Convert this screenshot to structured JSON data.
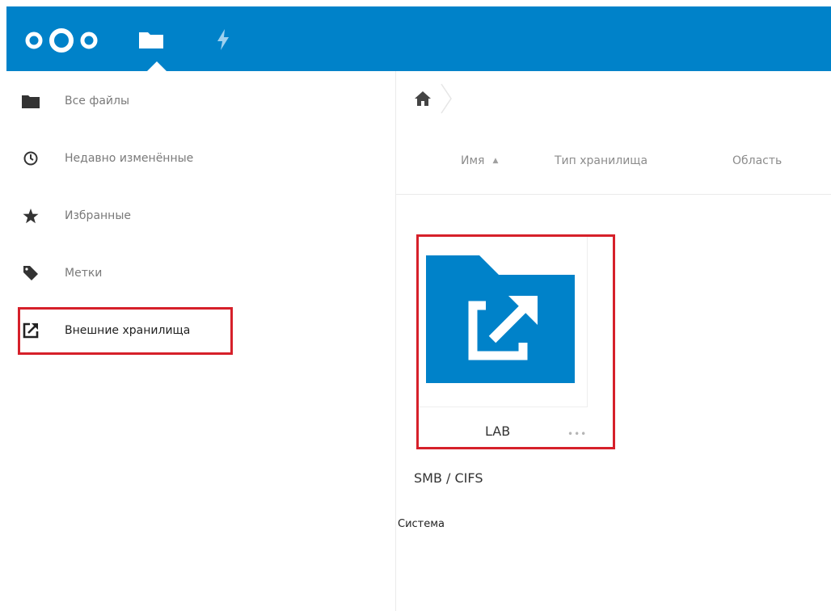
{
  "header": {
    "logo_icon": "nextcloud-logo",
    "nav": [
      {
        "icon": "folder-icon",
        "active": true
      },
      {
        "icon": "activity-icon",
        "active": false
      }
    ],
    "bar_color": "#0082c9"
  },
  "sidebar": {
    "items": [
      {
        "icon": "folder-icon",
        "label": "Все файлы"
      },
      {
        "icon": "clock-icon",
        "label": "Недавно изменённые"
      },
      {
        "icon": "star-icon",
        "label": "Избранные"
      },
      {
        "icon": "tag-icon",
        "label": "Метки"
      },
      {
        "icon": "external-link-icon",
        "label": "Внешние хранилища",
        "active": true
      }
    ]
  },
  "breadcrumb": {
    "home_icon": "home-icon"
  },
  "table": {
    "columns": {
      "name": "Имя",
      "type": "Тип хранилища",
      "scope": "Область"
    },
    "sort_indicator": "▲"
  },
  "files": [
    {
      "name": "LAB",
      "menu": "•••",
      "storage_type": "SMB / CIFS",
      "scope": "Система",
      "icon": "external-folder-icon"
    }
  ],
  "colors": {
    "accent": "#0082c9",
    "highlight": "#d6202a"
  }
}
